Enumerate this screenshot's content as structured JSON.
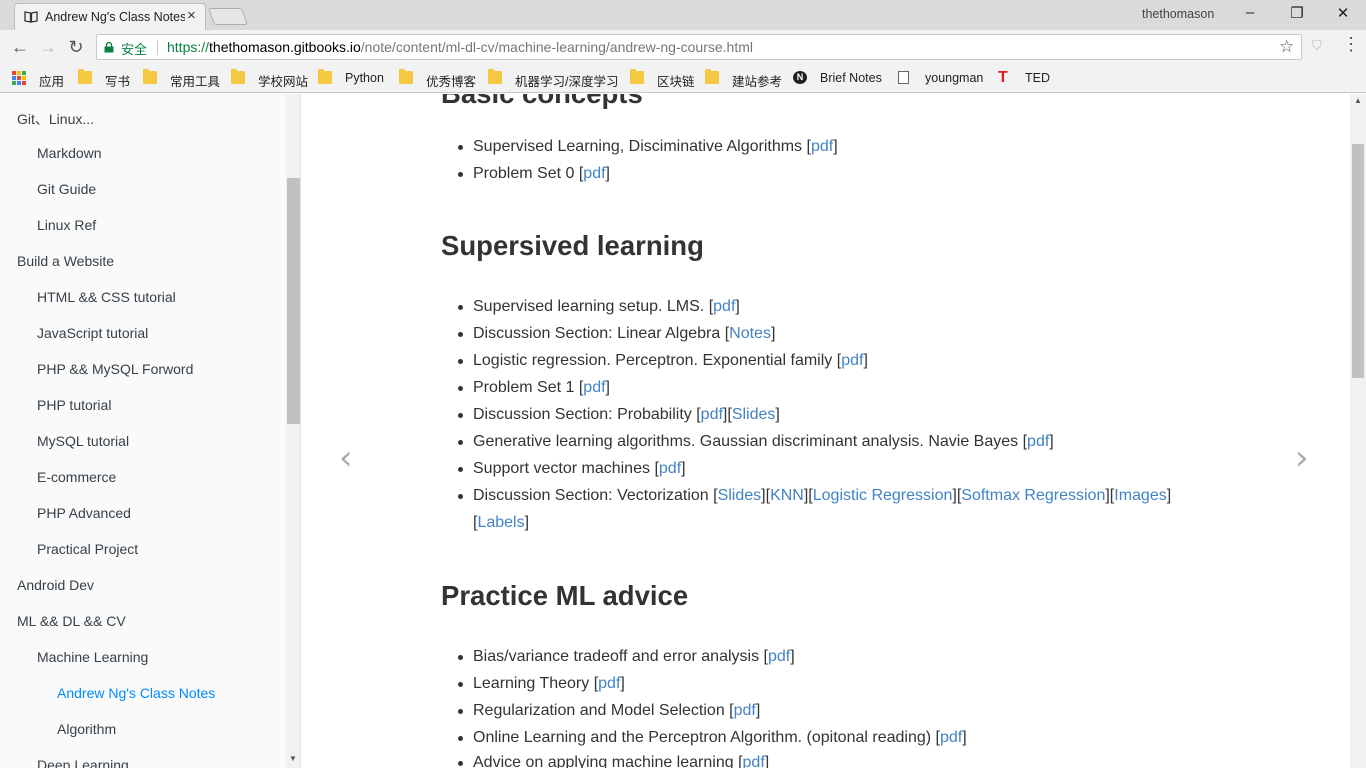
{
  "browser": {
    "tab_title": "Andrew Ng's Class Notes",
    "profile_name": "thethomason",
    "secure_label": "安全",
    "url": {
      "scheme": "https://",
      "host": "thethomason.gitbooks.io",
      "path": "/note/content/ml-dl-cv/machine-learning/andrew-ng-course.html"
    },
    "controls": {
      "back": "←",
      "forward": "→",
      "reload": "↻",
      "star": "☆",
      "menu": "⋮",
      "minimize": "–",
      "maximize": "❐",
      "close": "✕",
      "tab_close": "×"
    }
  },
  "bookmarks": [
    {
      "label": "应用",
      "icon": "apps-icon"
    },
    {
      "label": "写书",
      "icon": "folder-icon"
    },
    {
      "label": "常用工具",
      "icon": "folder-icon"
    },
    {
      "label": "学校网站",
      "icon": "folder-icon"
    },
    {
      "label": "Python",
      "icon": "folder-icon"
    },
    {
      "label": "优秀博客",
      "icon": "folder-icon"
    },
    {
      "label": "机器学习/深度学习",
      "icon": "folder-icon"
    },
    {
      "label": "区块链",
      "icon": "folder-icon"
    },
    {
      "label": "建站参考",
      "icon": "folder-icon"
    },
    {
      "label": "Brief Notes",
      "icon": "n-logo-icon"
    },
    {
      "label": "youngman",
      "icon": "page-icon"
    },
    {
      "label": "TED",
      "icon": "ted-icon"
    }
  ],
  "sidebar": {
    "items": [
      {
        "label": "Git、Linux..."
      },
      {
        "label": "Markdown"
      },
      {
        "label": "Git Guide"
      },
      {
        "label": "Linux Ref"
      },
      {
        "label": "Build a Website"
      },
      {
        "label": "HTML && CSS tutorial"
      },
      {
        "label": "JavaScript tutorial"
      },
      {
        "label": "PHP && MySQL Forword"
      },
      {
        "label": "PHP tutorial"
      },
      {
        "label": "MySQL tutorial"
      },
      {
        "label": "E-commerce"
      },
      {
        "label": "PHP Advanced"
      },
      {
        "label": "Practical Project"
      },
      {
        "label": "Android Dev"
      },
      {
        "label": "ML && DL && CV"
      },
      {
        "label": "Machine Learning"
      },
      {
        "label": "Andrew Ng's Class Notes",
        "active": true
      },
      {
        "label": "Algorithm"
      },
      {
        "label": "Deep Learning"
      }
    ]
  },
  "content": {
    "sections": [
      {
        "heading": "Basic concepts",
        "items": [
          {
            "text": "Supervised Learning, Disciminative Algorithms",
            "links": [
              "pdf"
            ]
          },
          {
            "text": "Problem Set 0",
            "links": [
              "pdf"
            ]
          }
        ]
      },
      {
        "heading": "Supersived learning",
        "items": [
          {
            "text": "Supervised learning setup. LMS.",
            "links": [
              "pdf"
            ]
          },
          {
            "text": "Discussion Section: Linear Algebra",
            "links": [
              "Notes"
            ]
          },
          {
            "text": "Logistic regression. Perceptron. Exponential family",
            "links": [
              "pdf"
            ]
          },
          {
            "text": "Problem Set 1",
            "links": [
              "pdf"
            ]
          },
          {
            "text": "Discussion Section: Probability",
            "links": [
              "pdf",
              "Slides"
            ]
          },
          {
            "text": "Generative learning algorithms. Gaussian discriminant analysis. Navie Bayes",
            "links": [
              "pdf"
            ]
          },
          {
            "text": "Support vector machines",
            "links": [
              "pdf"
            ]
          },
          {
            "text": "Discussion Section: Vectorization",
            "links": [
              "Slides",
              "KNN",
              "Logistic Regression",
              "Softmax Regression",
              "Images",
              "Labels"
            ]
          }
        ]
      },
      {
        "heading": "Practice ML advice",
        "items": [
          {
            "text": "Bias/variance tradeoff and error analysis",
            "links": [
              "pdf"
            ]
          },
          {
            "text": "Learning Theory",
            "links": [
              "pdf"
            ]
          },
          {
            "text": "Regularization and Model Selection",
            "links": [
              "pdf"
            ]
          },
          {
            "text": "Online Learning and the Perceptron Algorithm. (opitonal reading)",
            "links": [
              "pdf"
            ]
          },
          {
            "text": "Advice on applying machine learning",
            "links": [
              "pdf"
            ]
          }
        ]
      }
    ],
    "nav_prev": "‹",
    "nav_next": "›"
  },
  "colors": {
    "link": "#4183c4",
    "active_nav": "#008cff",
    "secure": "#0b8043",
    "text": "#333333"
  }
}
